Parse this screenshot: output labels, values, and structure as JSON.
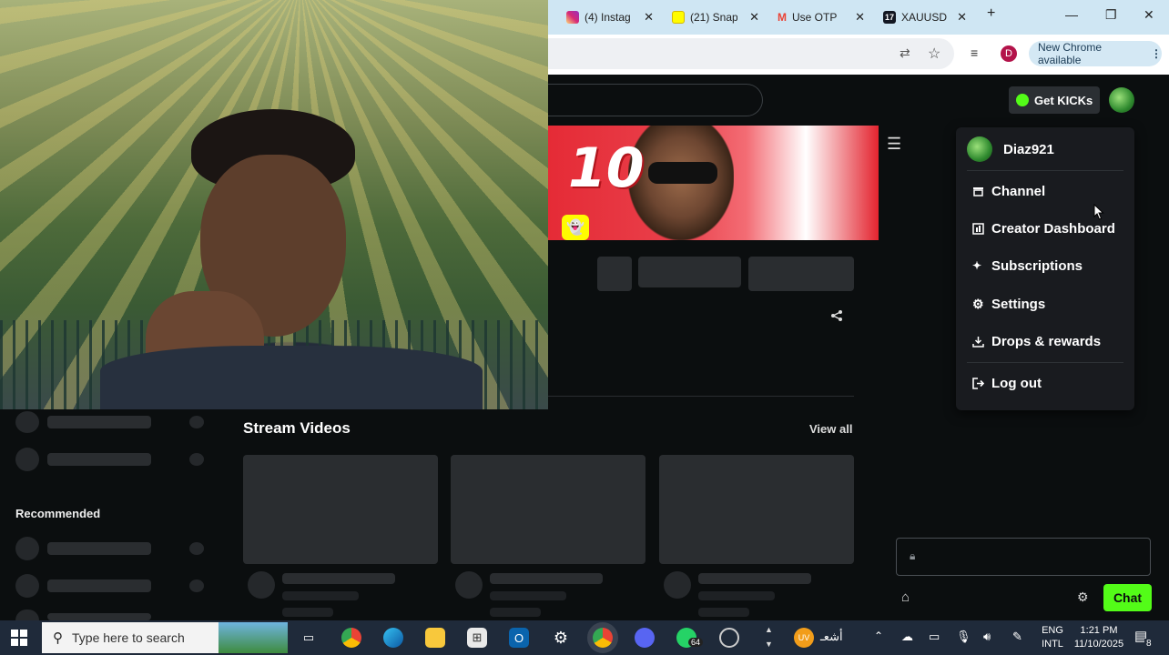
{
  "browser": {
    "tabs": [
      {
        "title": "(4) Instag",
        "icon": "instagram-icon",
        "color": "#d6249f"
      },
      {
        "title": "(21) Snap",
        "icon": "snapchat-icon",
        "color": "#fffc00"
      },
      {
        "title": "Use OTP",
        "icon": "gmail-icon",
        "color": "#ea4335"
      },
      {
        "title": "XAUUSD",
        "icon": "tradingview-icon",
        "color": "#131722"
      }
    ],
    "new_tab": "+",
    "window_controls": {
      "minimize": "—",
      "restore": "❐",
      "close": "✕"
    },
    "profile_initial": "D",
    "update_label": "New Chrome available"
  },
  "header": {
    "get_kicks": "Get KICKs"
  },
  "user_menu": {
    "username": "Diaz921",
    "items": [
      {
        "label": "Channel",
        "icon": "channel-icon"
      },
      {
        "label": "Creator Dashboard",
        "icon": "dashboard-icon"
      },
      {
        "label": "Subscriptions",
        "icon": "sparkle-icon"
      },
      {
        "label": "Settings",
        "icon": "gear-icon"
      },
      {
        "label": "Drops & rewards",
        "icon": "drops-icon"
      },
      {
        "label": "Log out",
        "icon": "logout-icon"
      }
    ]
  },
  "banner": {
    "number": "10"
  },
  "main": {
    "stream_videos_title": "Stream Videos",
    "view_all": "View all"
  },
  "sidebar": {
    "recommended_title": "Recommended"
  },
  "chat": {
    "send_label": "Chat"
  },
  "taskbar": {
    "search_placeholder": "Type here to search",
    "whatsapp_badge": "64",
    "notif_count": "8",
    "arabic_label": "أشعـ",
    "lang_top": "ENG",
    "lang_bottom": "INTL",
    "time": "1:21 PM",
    "date": "11/10/2025"
  }
}
